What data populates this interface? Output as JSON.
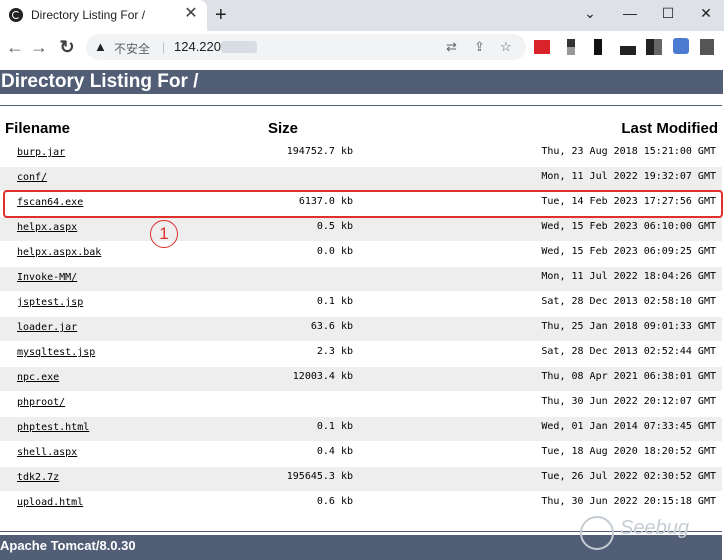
{
  "browser": {
    "tab_title": "Directory Listing For /",
    "tab_close": "✕",
    "new_tab": "+",
    "security_label": "不安全",
    "url": "124.220",
    "window_buttons": [
      "⌄",
      "—",
      "☐",
      "✕"
    ]
  },
  "page": {
    "title": "Directory Listing For /",
    "headers": {
      "filename": "Filename",
      "size": "Size",
      "last_modified": "Last Modified"
    },
    "files": [
      {
        "name": "burp.jar",
        "size": "194752.7 kb",
        "modified": "Thu, 23 Aug 2018 15:21:00 GMT"
      },
      {
        "name": "conf/",
        "size": "",
        "modified": "Mon, 11 Jul 2022 19:32:07 GMT"
      },
      {
        "name": "fscan64.exe",
        "size": "6137.0 kb",
        "modified": "Tue, 14 Feb 2023 17:27:56 GMT"
      },
      {
        "name": "helpx.aspx",
        "size": "0.5 kb",
        "modified": "Wed, 15 Feb 2023 06:10:00 GMT"
      },
      {
        "name": "helpx.aspx.bak",
        "size": "0.0 kb",
        "modified": "Wed, 15 Feb 2023 06:09:25 GMT"
      },
      {
        "name": "Invoke-MM/",
        "size": "",
        "modified": "Mon, 11 Jul 2022 18:04:26 GMT"
      },
      {
        "name": "jsptest.jsp",
        "size": "0.1 kb",
        "modified": "Sat, 28 Dec 2013 02:58:10 GMT"
      },
      {
        "name": "loader.jar",
        "size": "63.6 kb",
        "modified": "Thu, 25 Jan 2018 09:01:33 GMT"
      },
      {
        "name": "mysqltest.jsp",
        "size": "2.3 kb",
        "modified": "Sat, 28 Dec 2013 02:52:44 GMT"
      },
      {
        "name": "npc.exe",
        "size": "12003.4 kb",
        "modified": "Thu, 08 Apr 2021 06:38:01 GMT"
      },
      {
        "name": "phproot/",
        "size": "",
        "modified": "Thu, 30 Jun 2022 20:12:07 GMT"
      },
      {
        "name": "phptest.html",
        "size": "0.1 kb",
        "modified": "Wed, 01 Jan 2014 07:33:45 GMT"
      },
      {
        "name": "shell.aspx",
        "size": "0.4 kb",
        "modified": "Tue, 18 Aug 2020 18:20:52 GMT"
      },
      {
        "name": "tdk2.7z",
        "size": "195645.3 kb",
        "modified": "Tue, 26 Jul 2022 02:30:52 GMT"
      },
      {
        "name": "upload.html",
        "size": "0.6 kb",
        "modified": "Thu, 30 Jun 2022 20:15:18 GMT"
      }
    ],
    "footer": "Apache Tomcat/8.0.30"
  },
  "annotation": {
    "marker_label": "1",
    "highlighted_file": "fscan64.exe"
  },
  "watermark": {
    "text": "Seebug"
  },
  "colors": {
    "header_bar": "#525d76",
    "row_shade": "#eeeeee",
    "annotation_red": "#e0302b"
  }
}
